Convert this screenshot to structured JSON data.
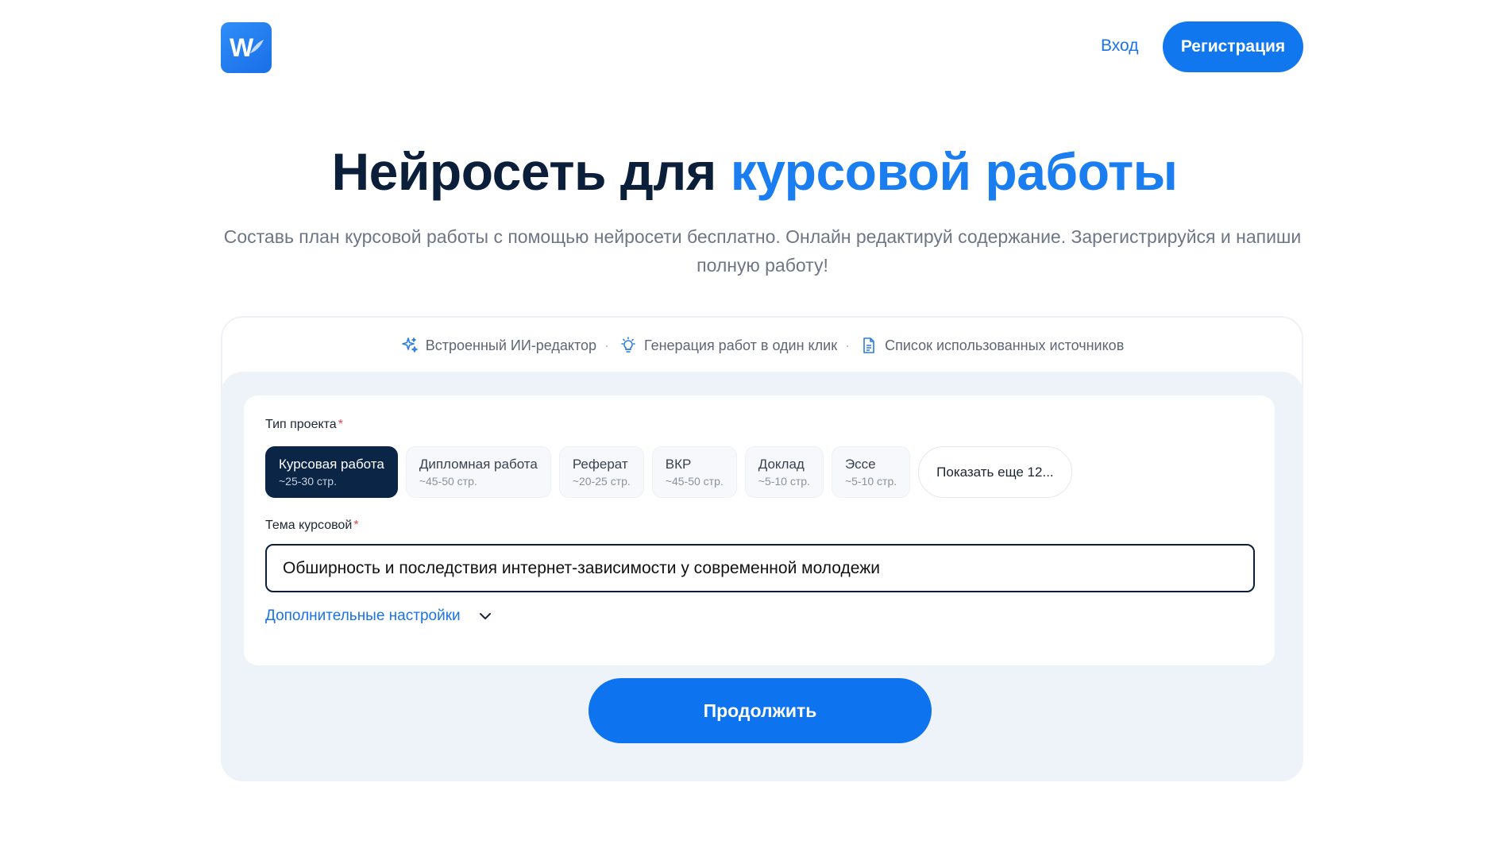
{
  "header": {
    "logo_letter": "W",
    "login_label": "Вход",
    "register_label": "Регистрация"
  },
  "hero": {
    "title_main": "Нейросеть для",
    "title_accent": "курсовой работы",
    "subtitle": "Составь план курсовой работы с помощью нейросети бесплатно. Онлайн редактируй содержание. Зарегистрируйся и напиши полную работу!"
  },
  "features": [
    {
      "icon": "sparkles-icon",
      "label": "Встроенный ИИ-редактор"
    },
    {
      "icon": "lightbulb-icon",
      "label": "Генерация работ в один клик"
    },
    {
      "icon": "document-icon",
      "label": "Список использованных источников"
    }
  ],
  "form": {
    "project_type_label": "Тип проекта",
    "required_mark": "*",
    "project_types": [
      {
        "title": "Курсовая работа",
        "pages": "~25-30 стр.",
        "active": true
      },
      {
        "title": "Дипломная работа",
        "pages": "~45-50 стр.",
        "active": false
      },
      {
        "title": "Реферат",
        "pages": "~20-25 стр.",
        "active": false
      },
      {
        "title": "ВКР",
        "pages": "~45-50 стр.",
        "active": false
      },
      {
        "title": "Доклад",
        "pages": "~5-10 стр.",
        "active": false
      },
      {
        "title": "Эссе",
        "pages": "~5-10 стр.",
        "active": false
      }
    ],
    "show_more_label": "Показать еще 12...",
    "topic_label": "Тема курсовой",
    "topic_value": "Обширность и последствия интернет-зависимости у современной молодежи",
    "extra_settings_label": "Дополнительные настройки",
    "continue_label": "Продолжить"
  },
  "colors": {
    "accent": "#1177ef",
    "dark": "#0b2547",
    "required": "#e5484d"
  }
}
